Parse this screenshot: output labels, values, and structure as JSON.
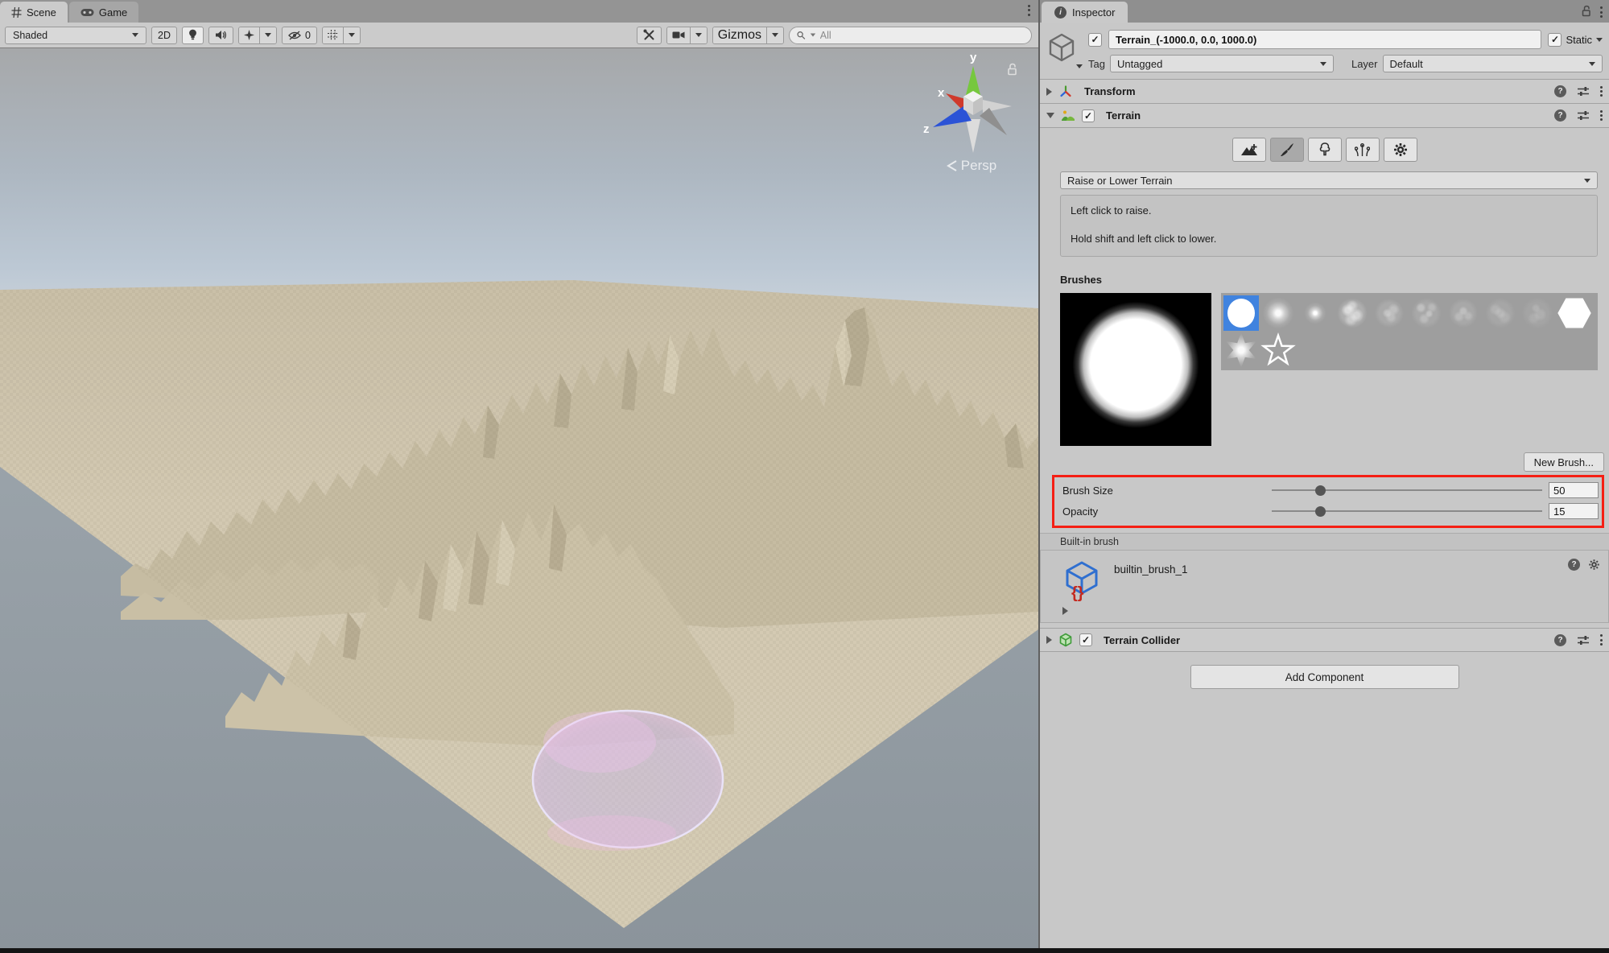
{
  "scene": {
    "tabs": [
      {
        "label": "Scene"
      },
      {
        "label": "Game"
      }
    ],
    "toolbar": {
      "shading": "Shaded",
      "mode2d": "2D",
      "hidden_count": "0",
      "gizmos": "Gizmos",
      "search_placeholder": "All"
    },
    "gizmo": {
      "x": "x",
      "y": "y",
      "z": "z",
      "persp": "Persp"
    }
  },
  "inspector": {
    "tab": "Inspector",
    "header": {
      "name": "Terrain_(-1000.0, 0.0, 1000.0)",
      "static": "Static",
      "tag_label": "Tag",
      "tag_value": "Untagged",
      "layer_label": "Layer",
      "layer_value": "Default"
    },
    "transform": {
      "title": "Transform"
    },
    "terrain": {
      "title": "Terrain",
      "tools": [
        "create-neighbor-terrains",
        "paint-terrain",
        "paint-trees",
        "paint-details",
        "terrain-settings"
      ],
      "active_tool": "paint-terrain",
      "paint_mode": "Raise or Lower Terrain",
      "help_line1": "Left click to raise.",
      "help_line2": "Hold shift and left click to lower.",
      "brushes_label": "Brushes",
      "palette_icons": [
        "circle-solid-selected",
        "circle-soft",
        "dot-soft",
        "noise-blob-1",
        "noise-blob-2",
        "noise-scatter-1",
        "noise-scatter-2",
        "noise-ring",
        "noise-streaks",
        "hexagon-solid",
        "star-six-soft",
        "star-five-outline"
      ],
      "new_brush": "New Brush...",
      "brush_size": {
        "label": "Brush Size",
        "value": "50",
        "slider_pct": 16
      },
      "opacity": {
        "label": "Opacity",
        "value": "15",
        "slider_pct": 16
      },
      "builtin_label": "Built-in brush",
      "asset_name": "builtin_brush_1"
    },
    "collider": {
      "title": "Terrain Collider"
    },
    "add_component": "Add Component"
  },
  "colors": {
    "selection_blue": "#4083df",
    "highlight_red": "#f51f14",
    "panel_gray": "#c8c8c8",
    "terrain_beige": "#d2c8b1",
    "sky_blue": "#b6c3d1",
    "brush_overlay_lavender": "#beaFe6"
  }
}
